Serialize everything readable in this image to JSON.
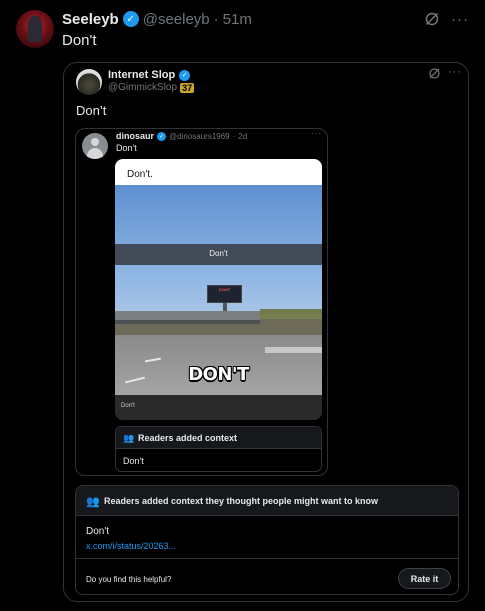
{
  "post": {
    "author_name": "Seeleyb",
    "author_handle": "@seeleyb",
    "separator": "·",
    "time": "51m",
    "text": "Don't",
    "verified_mark": "✓",
    "more": "···"
  },
  "quote": {
    "author_name": "Internet Slop",
    "author_handle": "@GimmickSlop",
    "badge": "37",
    "text": "Don’t",
    "more": "···",
    "nested_quote": {
      "author_name": "dinosaur",
      "author_handle": "@dinosaurs1969",
      "separator": "·",
      "time": "2d",
      "text": "Don't",
      "more": "···",
      "media": {
        "top_caption": "Don't.",
        "band_caption": "Don't",
        "billboard_text": "DONT",
        "overlay_text": "DON'T",
        "bottom_caption": "Don't"
      },
      "context": {
        "title": "Readers added context",
        "body": "Don't",
        "icon": "people-icon"
      }
    },
    "community_note": {
      "title": "Readers added context they thought people might want to know",
      "body": "Don't",
      "link_text": "x.com/i/status/20263...",
      "question": "Do you find this helpful?",
      "rate_label": "Rate it",
      "icon": "people-icon"
    }
  },
  "colors": {
    "accent": "#1d9bf0",
    "background": "#000000",
    "text": "#e7e9ea",
    "muted": "#71767b",
    "border": "#2f3336",
    "badge": "#caa52b"
  }
}
